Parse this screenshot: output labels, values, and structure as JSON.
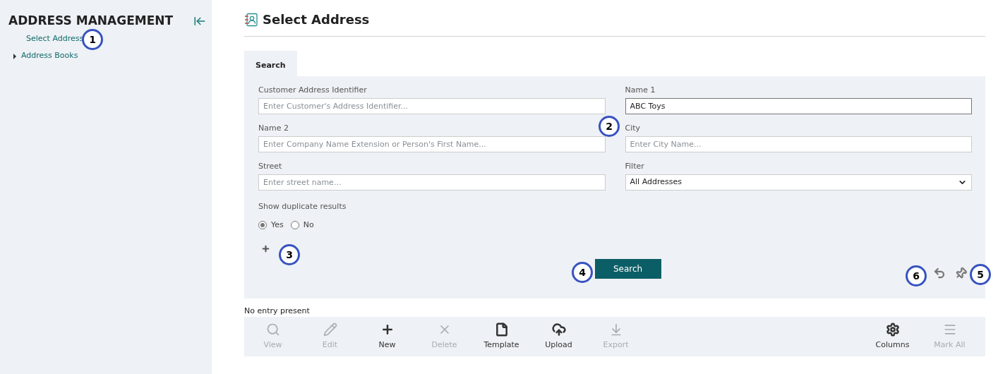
{
  "sidebar": {
    "title": "ADDRESS MANAGEMENT",
    "items": [
      {
        "label": "Select Address",
        "selected": true,
        "expandable": false
      },
      {
        "label": "Address Books",
        "selected": false,
        "expandable": true
      }
    ]
  },
  "page": {
    "title": "Select Address"
  },
  "tabs": [
    {
      "label": "Search",
      "selected": true
    }
  ],
  "fields": [
    {
      "kind": "text",
      "label": "Customer Address Identifier",
      "placeholder": "Enter Customer's Address Identifier..."
    },
    {
      "kind": "text",
      "label": "Name 1",
      "value": "ABC Toys",
      "focused": true
    },
    {
      "kind": "text",
      "label": "Name 2",
      "placeholder": "Enter Company Name Extension or Person's First Name..."
    },
    {
      "kind": "text",
      "label": "City",
      "placeholder": "Enter City Name..."
    },
    {
      "kind": "text",
      "label": "Street",
      "placeholder": "Enter street name..."
    },
    {
      "kind": "select",
      "label": "Filter",
      "value": "All Addresses"
    }
  ],
  "duplicates": {
    "label": "Show duplicate results",
    "options": [
      {
        "label": "Yes",
        "selected": true
      },
      {
        "label": "No",
        "selected": false
      }
    ]
  },
  "search_button": "Search",
  "result_message": "No entry present",
  "toolbar": [
    {
      "label": "View",
      "disabled": true
    },
    {
      "label": "Edit",
      "disabled": true
    },
    {
      "label": "New",
      "disabled": false
    },
    {
      "label": "Delete",
      "disabled": true
    },
    {
      "label": "Template",
      "disabled": false
    },
    {
      "label": "Upload",
      "disabled": false
    },
    {
      "label": "Export",
      "disabled": true
    }
  ],
  "toolbar_right": [
    {
      "label": "Columns",
      "disabled": false
    },
    {
      "label": "Mark All",
      "disabled": true
    }
  ],
  "callouts": [
    "1",
    "2",
    "3",
    "4",
    "6",
    "5"
  ]
}
